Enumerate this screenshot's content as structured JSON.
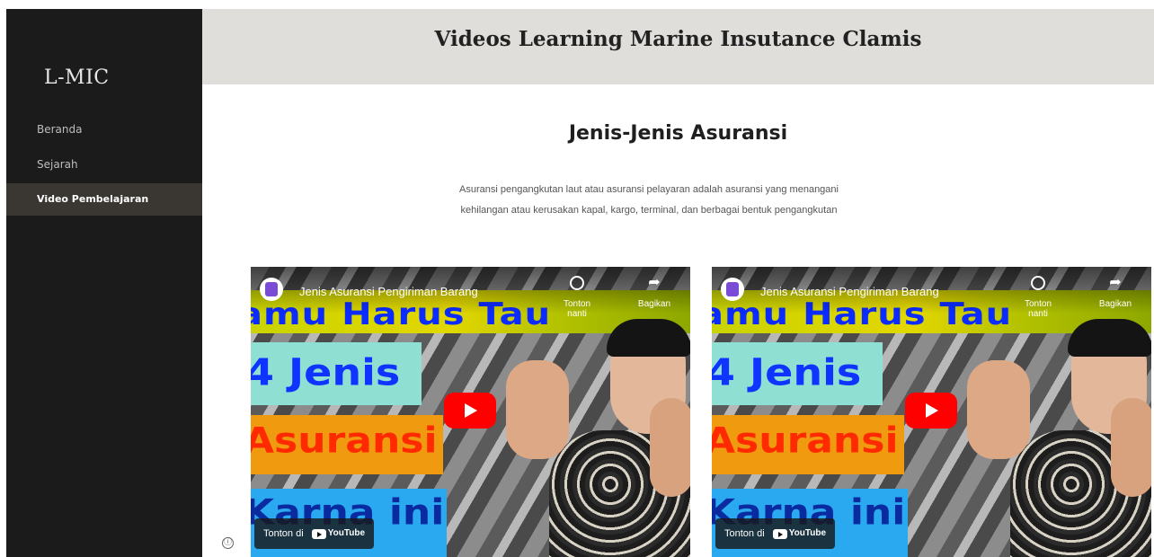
{
  "app": {
    "logo": "L-MIC"
  },
  "sidebar": {
    "items": [
      {
        "label": "Beranda",
        "active": false
      },
      {
        "label": "Sejarah",
        "active": false
      },
      {
        "label": "Video Pembelajaran",
        "active": true
      }
    ]
  },
  "header": {
    "title": "Videos Learning Marine Insutance Clamis"
  },
  "main": {
    "section_title": "Jenis-Jenis Asuransi",
    "description_line1": "Asuransi pengangkutan laut atau asuransi pelayaran adalah asuransi yang menangani",
    "description_line2": "kehilangan atau kerusakan kapal, kargo, terminal, dan berbagai bentuk pengangkutan",
    "info_icon": "ⓘ"
  },
  "videos": [
    {
      "title": "Jenis Asuransi Pengiriman Barang",
      "watch_later_label": "Tonton nanti",
      "share_label": "Bagikan",
      "watch_on_label": "Tonton di",
      "youtube_label": "YouTube",
      "thumb_line1": "amu Harus Tau",
      "thumb_line2": "4 Jenis",
      "thumb_line3": "Asuransi",
      "thumb_line4": "Karna ini"
    },
    {
      "title": "Jenis Asuransi Pengiriman Barang",
      "watch_later_label": "Tonton nanti",
      "share_label": "Bagikan",
      "watch_on_label": "Tonton di",
      "youtube_label": "YouTube",
      "thumb_line1": "amu Harus Tau",
      "thumb_line2": "4 Jenis",
      "thumb_line3": "Asuransi",
      "thumb_line4": "Karna ini"
    }
  ],
  "colors": {
    "sidebar_bg": "#1b1b1b",
    "sidebar_active_bg": "#3a3733",
    "header_bg": "#dfdeda",
    "play_button": "#ff0000"
  },
  "icons": {
    "info": "info-icon",
    "play": "play-icon",
    "watch_later": "clock-icon",
    "share": "share-icon",
    "youtube": "youtube-logo-icon"
  }
}
